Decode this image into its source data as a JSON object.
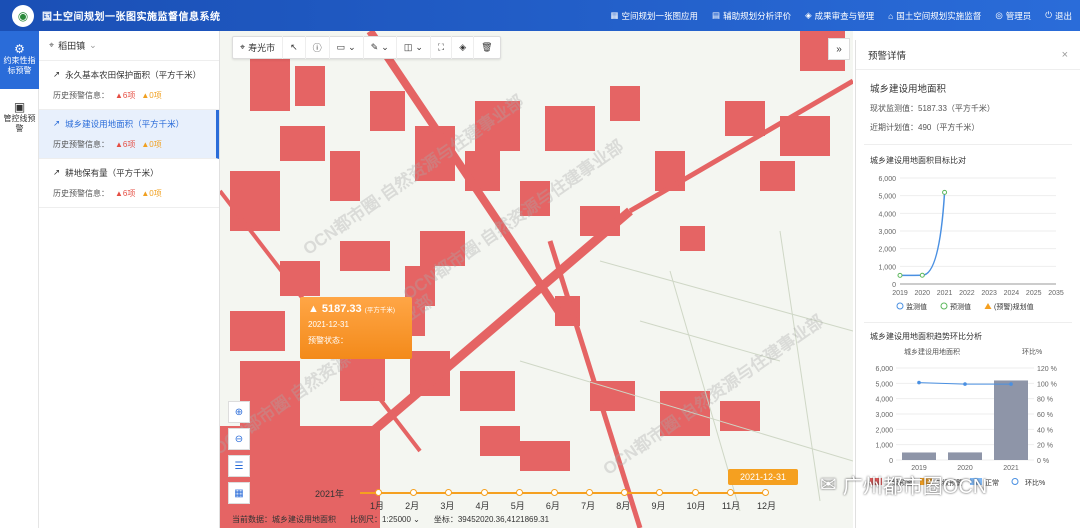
{
  "app": {
    "title": "国土空间规划一张图实施监督信息系统",
    "logo_icon": "emblem-icon"
  },
  "topnav": [
    {
      "label": "空间规划一张图应用",
      "icon": "map-icon"
    },
    {
      "label": "辅助规划分析评价",
      "icon": "analysis-icon"
    },
    {
      "label": "成果审查与管理",
      "icon": "review-icon"
    },
    {
      "label": "国土空间规划实施监督",
      "icon": "monitor-icon"
    },
    {
      "label": "管理员",
      "icon": "user-icon"
    },
    {
      "label": "退出",
      "icon": "power-icon"
    }
  ],
  "leftnav": [
    {
      "label": "约束性指标预警",
      "active": true
    },
    {
      "label": "管控线预警",
      "active": false
    }
  ],
  "panel": {
    "town": "稻田镇",
    "indicators": [
      {
        "name": "永久基本农田保护面积（平方千米）",
        "history_label": "历史预警信息：",
        "red": "6项",
        "orange": "0项",
        "active": false
      },
      {
        "name": "城乡建设用地面积（平方千米）",
        "history_label": "历史预警信息：",
        "red": "6项",
        "orange": "0项",
        "active": true
      },
      {
        "name": "耕地保有量（平方千米）",
        "history_label": "历史预警信息：",
        "red": "6项",
        "orange": "0项",
        "active": false
      }
    ]
  },
  "map": {
    "city": "寿光市",
    "popup": {
      "value": "5187.33",
      "unit": "(平方千米)",
      "date": "2021-12-31",
      "status": "预警状态："
    },
    "timeline": {
      "year": "2021年",
      "months": [
        "1月",
        "2月",
        "3月",
        "4月",
        "5月",
        "6月",
        "7月",
        "8月",
        "9月",
        "10月",
        "11月",
        "12月"
      ],
      "current": "2021-12-31"
    },
    "status": {
      "data_label": "当前数据：",
      "data_value": "城乡建设用地面积",
      "scale_label": "比例尺：",
      "scale_value": "1:25000",
      "coord_label": "坐标：",
      "coord_value": "39452020.36,4121869.31"
    },
    "watermarks": [
      "OCN都市圈·自然资源与住建事业部",
      "OCN都市圈·自然资源与住建事业部",
      "OCN都市圈·自然资源与住建事业部",
      "OCN都市圈·自然资源与住建事业部"
    ]
  },
  "detail": {
    "title": "预警详情",
    "subject": "城乡建设用地面积",
    "current_label": "现状监测值：5187.33（平方千米）",
    "planned_label": "近期计划值：490（平方千米）",
    "chart1_title": "城乡建设用地面积目标比对",
    "chart2_title": "城乡建设用地面积趋势环比分析"
  },
  "chart_data": [
    {
      "type": "line",
      "title": "城乡建设用地面积目标比对",
      "x": [
        "2019",
        "2020",
        "2021",
        "2022",
        "2023",
        "2024",
        "2025",
        "2035"
      ],
      "ylim": [
        0,
        6000
      ],
      "yticks": [
        "0",
        "1,000",
        "2,000",
        "3,000",
        "4,000",
        "5,000",
        "6,000"
      ],
      "series": [
        {
          "name": "监测值",
          "values": [
            490,
            495,
            5187.33
          ],
          "color": "#4a90e2"
        },
        {
          "name": "预测值",
          "values": [
            490,
            495,
            5187.33
          ],
          "color": "#5cb85c"
        },
        {
          "name": "(预警)规划值",
          "values": [],
          "color": "#f5a020"
        }
      ]
    },
    {
      "type": "bar",
      "title": "城乡建设用地面积趋势环比分析",
      "subtitle_left": "城乡建设用地面积",
      "subtitle_right": "环比%",
      "categories": [
        "2019",
        "2020",
        "2021"
      ],
      "ylim": [
        0,
        6000
      ],
      "yticks": [
        "0",
        "1,000",
        "2,000",
        "3,000",
        "4,000",
        "5,000",
        "6,000"
      ],
      "y2ticks": [
        "0 %",
        "20 %",
        "40 %",
        "60 %",
        "80 %",
        "100 %",
        "120 %"
      ],
      "values": [
        490,
        495,
        5187.33
      ],
      "ratio": [
        101,
        99,
        99
      ],
      "legend": [
        {
          "name": "一级预警",
          "color": "#e55a5a"
        },
        {
          "name": "二级预警",
          "color": "#f5a020"
        },
        {
          "name": "正常",
          "color": "#7fb8f5"
        },
        {
          "name": "环比%",
          "color": "#4a90e2"
        }
      ]
    }
  ],
  "brand": "广州都市圈OCN"
}
